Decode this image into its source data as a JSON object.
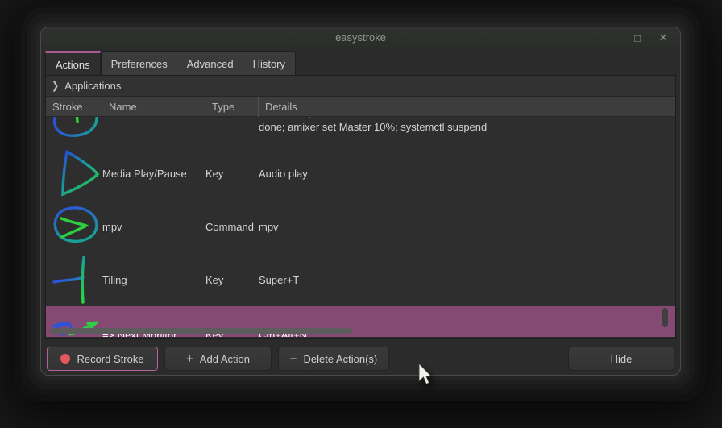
{
  "window": {
    "title": "easystroke",
    "controls": {
      "minimize": "–",
      "maximize": "□",
      "close": "✕"
    }
  },
  "tabs": [
    {
      "label": "Actions",
      "active": true
    },
    {
      "label": "Preferences",
      "active": false
    },
    {
      "label": "Advanced",
      "active": false
    },
    {
      "label": "History",
      "active": false
    }
  ],
  "tree": {
    "expander_label": "Applications",
    "columns": [
      "Stroke",
      "Name",
      "Type",
      "Details"
    ],
    "rows": [
      {
        "stroke_icon": "circle-with-tick-stroke",
        "name": "",
        "type": "",
        "details_line1": "wmctrl -ie $window",
        "details_line2": "done; amixer set Master 10%; systemctl suspend"
      },
      {
        "stroke_icon": "play-triangle-stroke",
        "name": "Media Play/Pause",
        "type": "Key",
        "details": "Audio play"
      },
      {
        "stroke_icon": "ellipse-arrow-stroke",
        "name": "mpv",
        "type": "Command",
        "details": "mpv"
      },
      {
        "stroke_icon": "corner-line-stroke",
        "name": "Tiling",
        "type": "Key",
        "details": "Super+T"
      },
      {
        "stroke_icon": "loop-arrow-stroke",
        "name": "=> Next Monitor",
        "type": "Key",
        "details": "Ctrl+Alt+N",
        "selected": true
      }
    ]
  },
  "buttons": {
    "record": "Record Stroke",
    "add": "Add Action",
    "add_icon": "+",
    "delete": "Delete Action(s)",
    "delete_icon": "−",
    "hide": "Hide"
  },
  "expander_chevron": "❯",
  "colors": {
    "accent_pink": "#a85c92",
    "selection": "#854a74",
    "record_dot": "#e4575f",
    "stroke_blue": "#2b52d8",
    "stroke_teal": "#1a9f96",
    "stroke_green": "#2dd040"
  }
}
